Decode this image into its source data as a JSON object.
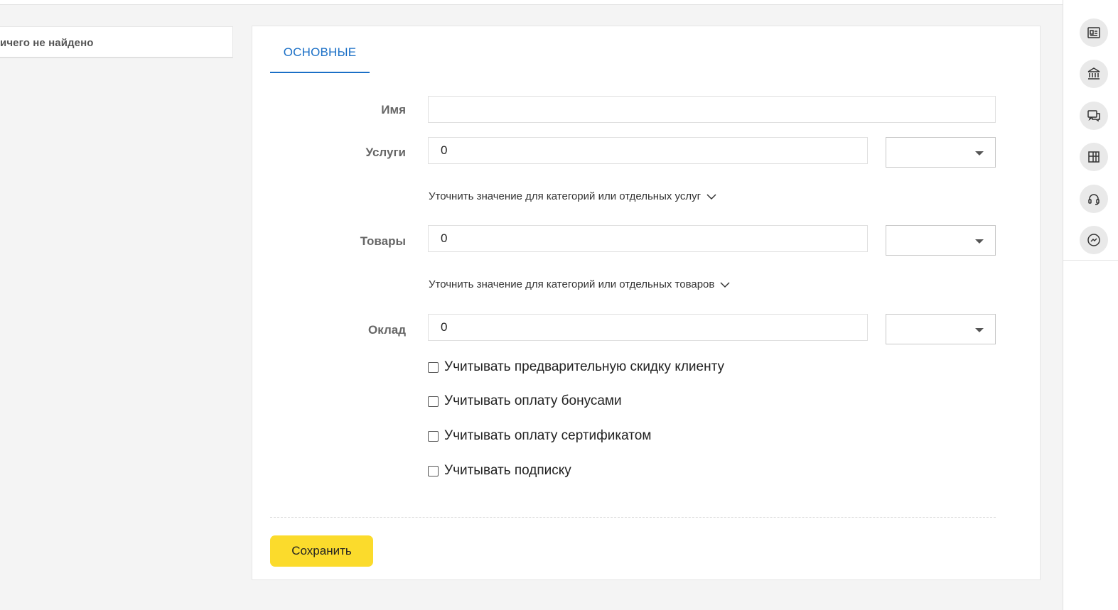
{
  "left_panel": {
    "text": "ичего не найдено"
  },
  "tabs": [
    {
      "label": "ОСНОВНЫЕ"
    }
  ],
  "form": {
    "name": {
      "label": "Имя",
      "value": ""
    },
    "services": {
      "label": "Услуги",
      "value": "0",
      "select_value": "",
      "refine_label": "Уточнить значение для категорий или отдельных услуг"
    },
    "goods": {
      "label": "Товары",
      "value": "0",
      "select_value": "",
      "refine_label": "Уточнить значение для категорий или отдельных товаров"
    },
    "salary": {
      "label": "Оклад",
      "value": "0",
      "select_value": ""
    },
    "checkboxes": [
      {
        "label": "Учитывать предварительную скидку клиенту",
        "checked": false
      },
      {
        "label": "Учитывать оплату бонусами",
        "checked": false
      },
      {
        "label": "Учитывать оплату сертификатом",
        "checked": false
      },
      {
        "label": "Учитывать подписку",
        "checked": false
      }
    ]
  },
  "actions": {
    "save_label": "Сохранить"
  },
  "sidebar_icons": [
    "id-card-icon",
    "bank-icon",
    "chat-icon",
    "layout-icon",
    "headset-icon",
    "messenger-icon"
  ],
  "colors": {
    "accent": "#1a6fc6",
    "button": "#fbdb2c"
  }
}
